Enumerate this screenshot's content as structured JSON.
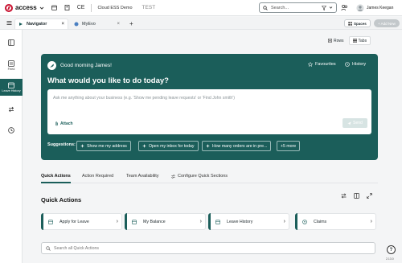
{
  "topbar": {
    "brand": "access",
    "ce_label": "CE",
    "environment": "Cloud ESS Demo",
    "test_label": "TEST",
    "search_placeholder": "Search...",
    "user_name": "James Keegan"
  },
  "tabs": [
    {
      "label": "Navigator",
      "active": true
    },
    {
      "label": "MyEvo",
      "active": false
    }
  ],
  "tabrow": {
    "spaces_label": "Spaces",
    "add_new_label": "+ Add New"
  },
  "sidebar": {
    "items": [
      {
        "label": "",
        "icon": "panel-icon"
      },
      {
        "label": "Feed",
        "icon": "feed-icon"
      },
      {
        "label": "Leave History",
        "icon": "calendar-icon",
        "active": true
      },
      {
        "label": "",
        "icon": "swap-icon"
      },
      {
        "label": "",
        "icon": "clock-icon"
      }
    ]
  },
  "view_toggle": {
    "rows_label": "Rows",
    "tabs_label": "Tabs",
    "active": "Tabs"
  },
  "hero": {
    "greeting": "Good morning James!",
    "favourites_label": "Favourites",
    "history_label": "History",
    "question": "What would you like to do today?",
    "ask_placeholder": "Ask me anything about your business (e.g. 'Show me pending leave requests' or 'Find John smith')",
    "attach_label": "Attach",
    "send_label": "Send",
    "suggestions_label": "Suggestions:",
    "suggestions": [
      "Show me my address",
      "Open my inbox for today",
      "How many orders are in pre...",
      "+5 more"
    ]
  },
  "content_tabs": {
    "items": [
      {
        "label": "Quick Actions",
        "active": true
      },
      {
        "label": "Action Required",
        "active": false
      },
      {
        "label": "Team Availability",
        "active": false
      },
      {
        "label": "Configure Quick Sections",
        "active": false
      }
    ]
  },
  "quick_actions": {
    "title": "Quick Actions",
    "cards": [
      {
        "label": "Apply for Leave",
        "icon": "calendar-icon"
      },
      {
        "label": "My Balance",
        "icon": "calendar-icon"
      },
      {
        "label": "Leave History",
        "icon": "calendar-icon"
      },
      {
        "label": "Claims",
        "icon": "claims-icon"
      }
    ],
    "search_placeholder": "Search all Quick Actions"
  },
  "footer": {
    "help_label": "?",
    "version": "2.13.0"
  },
  "colors": {
    "accent": "#1b5e5a",
    "brand_red": "#c8102e"
  }
}
